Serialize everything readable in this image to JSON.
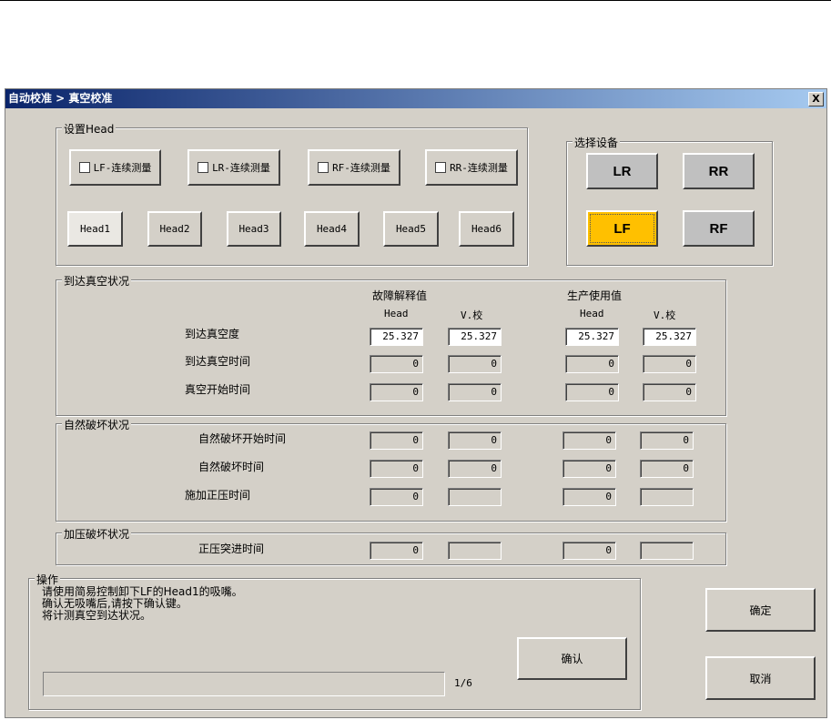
{
  "window": {
    "title": "自动校准 > 真空校准",
    "close_label": "X"
  },
  "head_group": {
    "label": "设置Head",
    "continuous": [
      "LF-连续测量",
      "LR-连续测量",
      "RF-连续测量",
      "RR-连续测量"
    ],
    "heads": [
      "Head1",
      "Head2",
      "Head3",
      "Head4",
      "Head5",
      "Head6"
    ],
    "selected_head": "Head1"
  },
  "device_group": {
    "label": "选择设备",
    "devices": [
      "LR",
      "RR",
      "LF",
      "RF"
    ],
    "selected": "LF",
    "accent": "#ffc000"
  },
  "vacuum_group": {
    "label": "到达真空状况",
    "col_group1": "故障解释值",
    "col_group2": "生产使用值",
    "subheaders": [
      "Head",
      "V.校",
      "Head",
      "V.校"
    ],
    "rows": [
      {
        "label": "到达真空度",
        "values": [
          "25.327",
          "25.327",
          "25.327",
          "25.327"
        ]
      },
      {
        "label": "到达真空时间",
        "values": [
          "0",
          "0",
          "0",
          "0"
        ]
      },
      {
        "label": "真空开始时间",
        "values": [
          "0",
          "0",
          "0",
          "0"
        ]
      }
    ]
  },
  "natural_group": {
    "label": "自然破坏状况",
    "rows": [
      {
        "label": "自然破坏开始时间",
        "values": [
          "0",
          "0",
          "0",
          "0"
        ]
      },
      {
        "label": "自然破坏时间",
        "values": [
          "0",
          "0",
          "0",
          "0"
        ]
      },
      {
        "label": "施加正压时间",
        "values": [
          "0",
          "",
          "0",
          ""
        ]
      }
    ]
  },
  "pressure_group": {
    "label": "加压破坏状况",
    "rows": [
      {
        "label": "正压突进时间",
        "values": [
          "0",
          "",
          "0",
          ""
        ]
      }
    ]
  },
  "operation": {
    "label": "操作",
    "lines": [
      "请使用简易控制卸下LF的Head1的吸嘴。",
      "确认无吸嘴后,请按下确认键。",
      "将计测真空到达状况。"
    ],
    "progress_text": "1/6",
    "progress": 0,
    "confirm_label": "确认"
  },
  "buttons": {
    "ok": "确定",
    "cancel": "取消"
  }
}
